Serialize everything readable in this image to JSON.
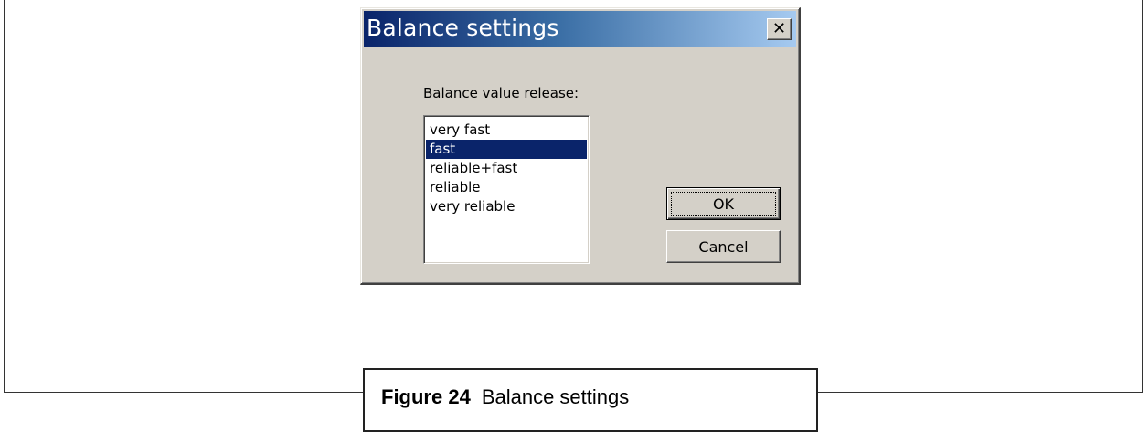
{
  "dialog": {
    "title": "Balance settings",
    "close_label": "✕",
    "release_label": "Balance value release:",
    "list_items": [
      {
        "label": "very fast",
        "selected": false
      },
      {
        "label": "fast",
        "selected": true
      },
      {
        "label": "reliable+fast",
        "selected": false
      },
      {
        "label": "reliable",
        "selected": false
      },
      {
        "label": "very reliable",
        "selected": false
      }
    ],
    "ok_label": "OK",
    "cancel_label": "Cancel"
  },
  "caption": {
    "number": "Figure 24",
    "text": "Balance settings"
  },
  "colors": {
    "titlebar_start": "#0a246a",
    "titlebar_end": "#a6caf0",
    "selection": "#0a246a",
    "dialog_face": "#d4d0c8"
  },
  "icons": {
    "close": "close-icon"
  }
}
